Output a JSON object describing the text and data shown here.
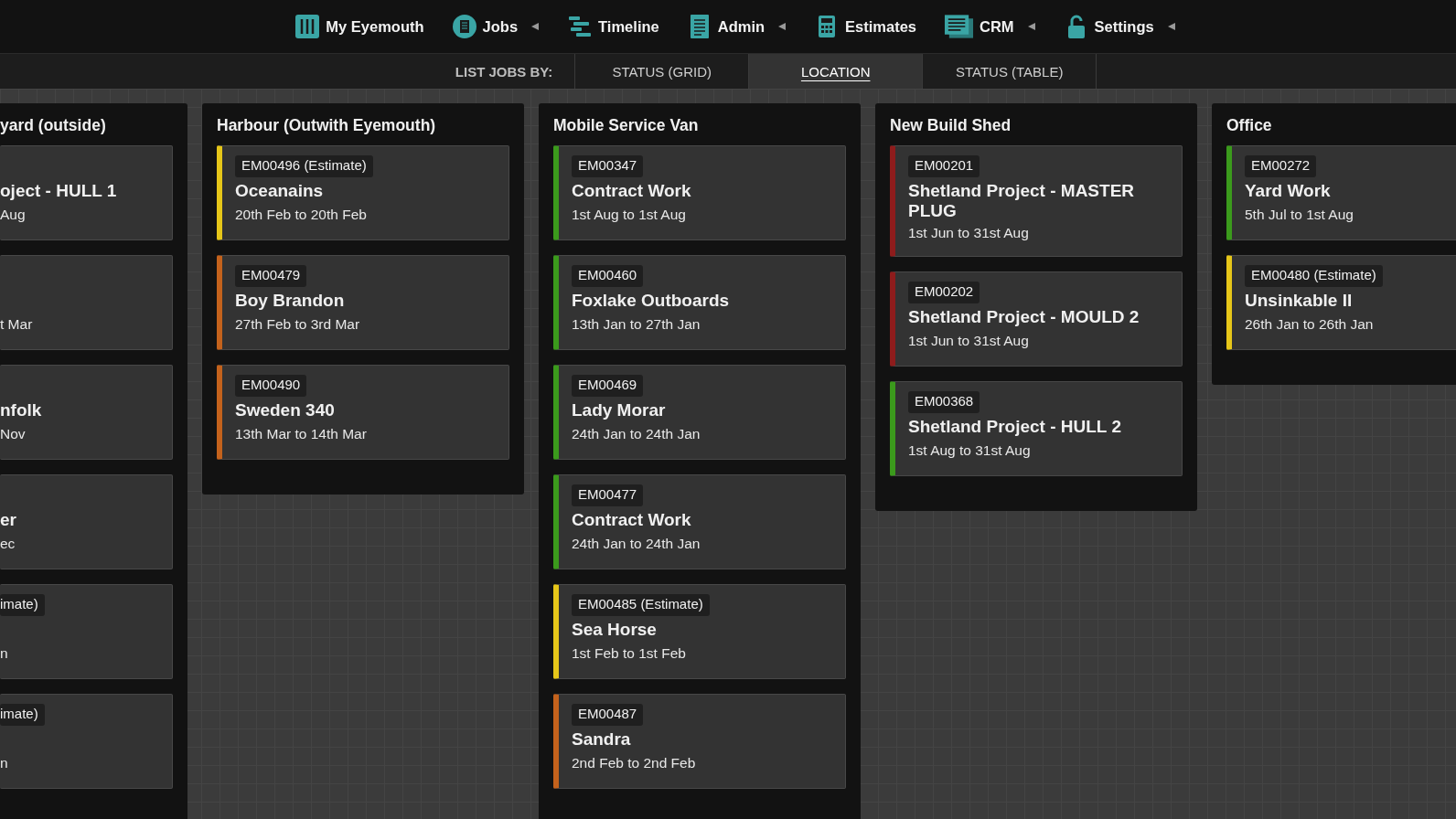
{
  "nav": [
    {
      "label": "My Eyemouth",
      "has_menu": false
    },
    {
      "label": "Jobs",
      "has_menu": true
    },
    {
      "label": "Timeline",
      "has_menu": false
    },
    {
      "label": "Admin",
      "has_menu": true
    },
    {
      "label": "Estimates",
      "has_menu": false
    },
    {
      "label": "CRM",
      "has_menu": true
    },
    {
      "label": "Settings",
      "has_menu": true
    }
  ],
  "list_by": {
    "label": "LIST JOBS BY:",
    "tabs": [
      {
        "label": "STATUS (GRID)",
        "selected": false
      },
      {
        "label": "LOCATION",
        "selected": true
      },
      {
        "label": "STATUS (TABLE)",
        "selected": false
      }
    ]
  },
  "columns": [
    {
      "kind": "partial",
      "title": "yard (outside)",
      "cards": [
        {
          "title": "oject - HULL 1",
          "dates": "Aug"
        },
        {
          "dates": "t Mar"
        },
        {
          "title": "nfolk",
          "dates": "Nov"
        },
        {
          "title": "er",
          "dates": "ec"
        },
        {
          "id": "imate)",
          "dates": "n"
        },
        {
          "id": "imate)",
          "dates": "n"
        }
      ]
    },
    {
      "kind": "full",
      "title": "Harbour (Outwith Eyemouth)",
      "cards": [
        {
          "id": "EM00496 (Estimate)",
          "title": "Oceanains",
          "dates": "20th Feb to 20th Feb",
          "color": "#e6c619"
        },
        {
          "id": "EM00479",
          "title": "Boy Brandon",
          "dates": "27th Feb to 3rd Mar",
          "color": "#c4621c"
        },
        {
          "id": "EM00490",
          "title": "Sweden 340",
          "dates": "13th Mar to 14th Mar",
          "color": "#c4621c"
        }
      ]
    },
    {
      "kind": "full",
      "title": "Mobile Service Van",
      "cards": [
        {
          "id": "EM00347",
          "title": "Contract Work",
          "dates": "1st Aug to 1st Aug",
          "color": "#3b9a1c"
        },
        {
          "id": "EM00460",
          "title": "Foxlake Outboards",
          "dates": "13th Jan to 27th Jan",
          "color": "#3b9a1c"
        },
        {
          "id": "EM00469",
          "title": "Lady Morar",
          "dates": "24th Jan to 24th Jan",
          "color": "#3b9a1c"
        },
        {
          "id": "EM00477",
          "title": "Contract Work",
          "dates": "24th Jan to 24th Jan",
          "color": "#3b9a1c"
        },
        {
          "id": "EM00485 (Estimate)",
          "title": "Sea Horse",
          "dates": "1st Feb to 1st Feb",
          "color": "#e6c619"
        },
        {
          "id": "EM00487",
          "title": "Sandra",
          "dates": "2nd Feb to 2nd Feb",
          "color": "#c4621c"
        }
      ]
    },
    {
      "kind": "full",
      "title": "New Build Shed",
      "cards": [
        {
          "id": "EM00201",
          "title": "Shetland Project - MASTER PLUG",
          "dates": "1st Jun to 31st Aug",
          "color": "#8e1c1c"
        },
        {
          "id": "EM00202",
          "title": "Shetland Project - MOULD 2",
          "dates": "1st Jun to 31st Aug",
          "color": "#8e1c1c"
        },
        {
          "id": "EM00368",
          "title": "Shetland Project - HULL 2",
          "dates": "1st Aug to 31st Aug",
          "color": "#3b9a1c"
        }
      ]
    },
    {
      "kind": "full",
      "title": "Office",
      "cards": [
        {
          "id": "EM00272",
          "title": "Yard Work",
          "dates": "5th Jul to 1st Aug",
          "color": "#3b9a1c"
        },
        {
          "id": "EM00480 (Estimate)",
          "title": "Unsinkable II",
          "dates": "26th Jan to 26th Jan",
          "color": "#e6c619"
        }
      ]
    }
  ]
}
